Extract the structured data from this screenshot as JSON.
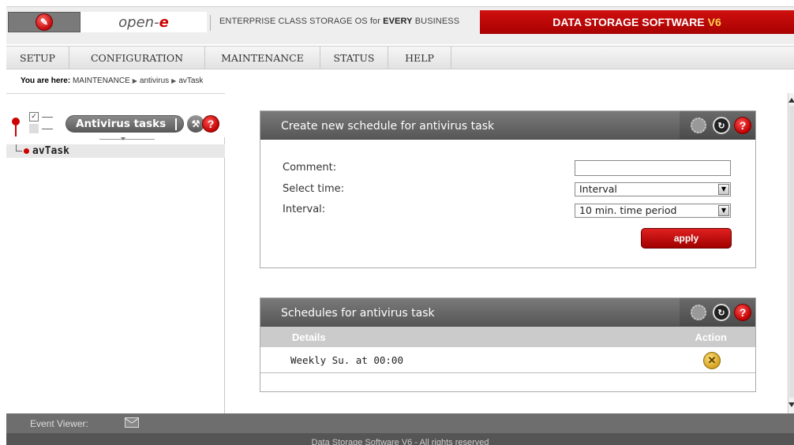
{
  "header": {
    "brand": "open-",
    "brand_e": "e",
    "tagline_pre": "ENTERPRISE CLASS STORAGE OS for ",
    "tagline_bold": "EVERY",
    "tagline_post": " BUSINESS",
    "product": "DATA STORAGE SOFTWARE",
    "product_version": "V6"
  },
  "nav": {
    "items": [
      {
        "label": "SETUP"
      },
      {
        "label": "CONFIGURATION"
      },
      {
        "label": "MAINTENANCE"
      },
      {
        "label": "STATUS"
      },
      {
        "label": "HELP"
      }
    ]
  },
  "breadcrumb": {
    "prefix": "You are here:",
    "crumbs": [
      "MAINTENANCE",
      "antivirus",
      "avTask"
    ]
  },
  "left_panel": {
    "title": "Antivirus tasks",
    "tree_item": "avTask"
  },
  "create_panel": {
    "title": "Create new schedule for antivirus task",
    "comment_label": "Comment:",
    "comment_value": "",
    "select_time_label": "Select time:",
    "select_time_value": "Interval",
    "interval_label": "Interval:",
    "interval_value": "10 min. time period",
    "apply_label": "apply"
  },
  "schedules_panel": {
    "title": "Schedules for antivirus task",
    "col_details": "Details",
    "col_action": "Action",
    "rows": [
      {
        "details": "Weekly Su. at 00:00"
      }
    ]
  },
  "event_viewer": {
    "label": "Event Viewer:"
  },
  "footer": {
    "text": "Data Storage Software V6 - All rights reserved"
  },
  "colors": {
    "brand_red": "#c00000",
    "panel_gray": "#666666",
    "accent_yellow": "#ffd24a"
  }
}
